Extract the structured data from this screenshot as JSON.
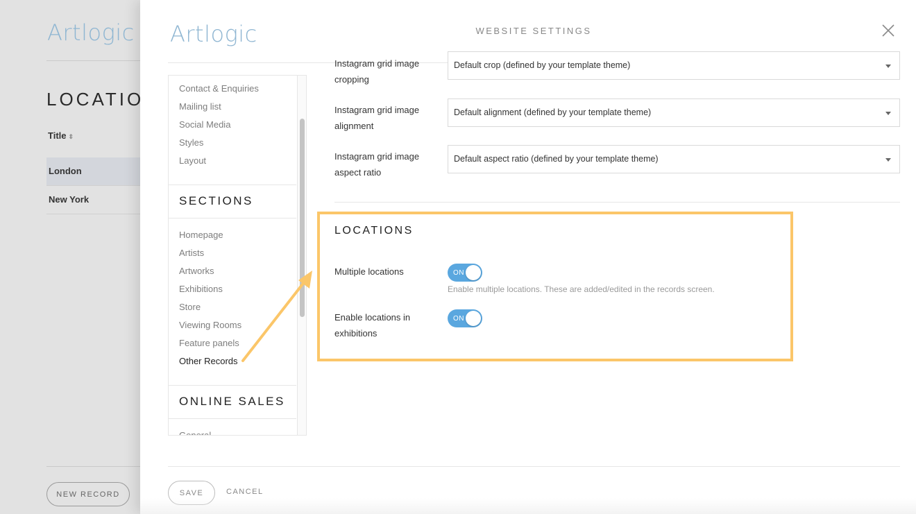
{
  "background": {
    "logo": "Artlogic",
    "heading": "LOCATION",
    "column_title": "Title",
    "sort_glyph": "⇕",
    "rows": [
      "London",
      "New York"
    ],
    "new_record_label": "NEW RECORD"
  },
  "modal": {
    "logo": "Artlogic",
    "title": "WEBSITE SETTINGS",
    "close_icon": "close-icon"
  },
  "sidebar": {
    "top_items": [
      "Contact & Enquiries",
      "Mailing list",
      "Social Media",
      "Styles",
      "Layout"
    ],
    "sections_heading": "SECTIONS",
    "section_items": [
      "Homepage",
      "Artists",
      "Artworks",
      "Exhibitions",
      "Store",
      "Viewing Rooms",
      "Feature panels",
      "Other Records"
    ],
    "active_item": "Other Records",
    "online_sales_heading": "ONLINE SALES",
    "online_sales_items": [
      "General"
    ]
  },
  "settings": {
    "rows": [
      {
        "label": "Instagram grid image cropping",
        "value": "Default crop (defined by your template theme)"
      },
      {
        "label": "Instagram grid image alignment",
        "value": "Default alignment (defined by your template theme)"
      },
      {
        "label": "Instagram grid image aspect ratio",
        "value": "Default aspect ratio (defined by your template theme)"
      }
    ]
  },
  "locations": {
    "heading": "LOCATIONS",
    "multiple_label": "Multiple locations",
    "multiple_state": "ON",
    "multiple_help": "Enable multiple locations. These are added/edited in the records screen.",
    "exhibitions_label": "Enable locations in exhibitions",
    "exhibitions_state": "ON"
  },
  "annotation": {
    "highlight_color": "#fbc669",
    "arrow_color": "#fbc669"
  },
  "footer": {
    "save_label": "SAVE",
    "cancel_label": "CANCEL"
  },
  "colors": {
    "accent": "#5aa7df",
    "logo": "#8fb6d2"
  }
}
